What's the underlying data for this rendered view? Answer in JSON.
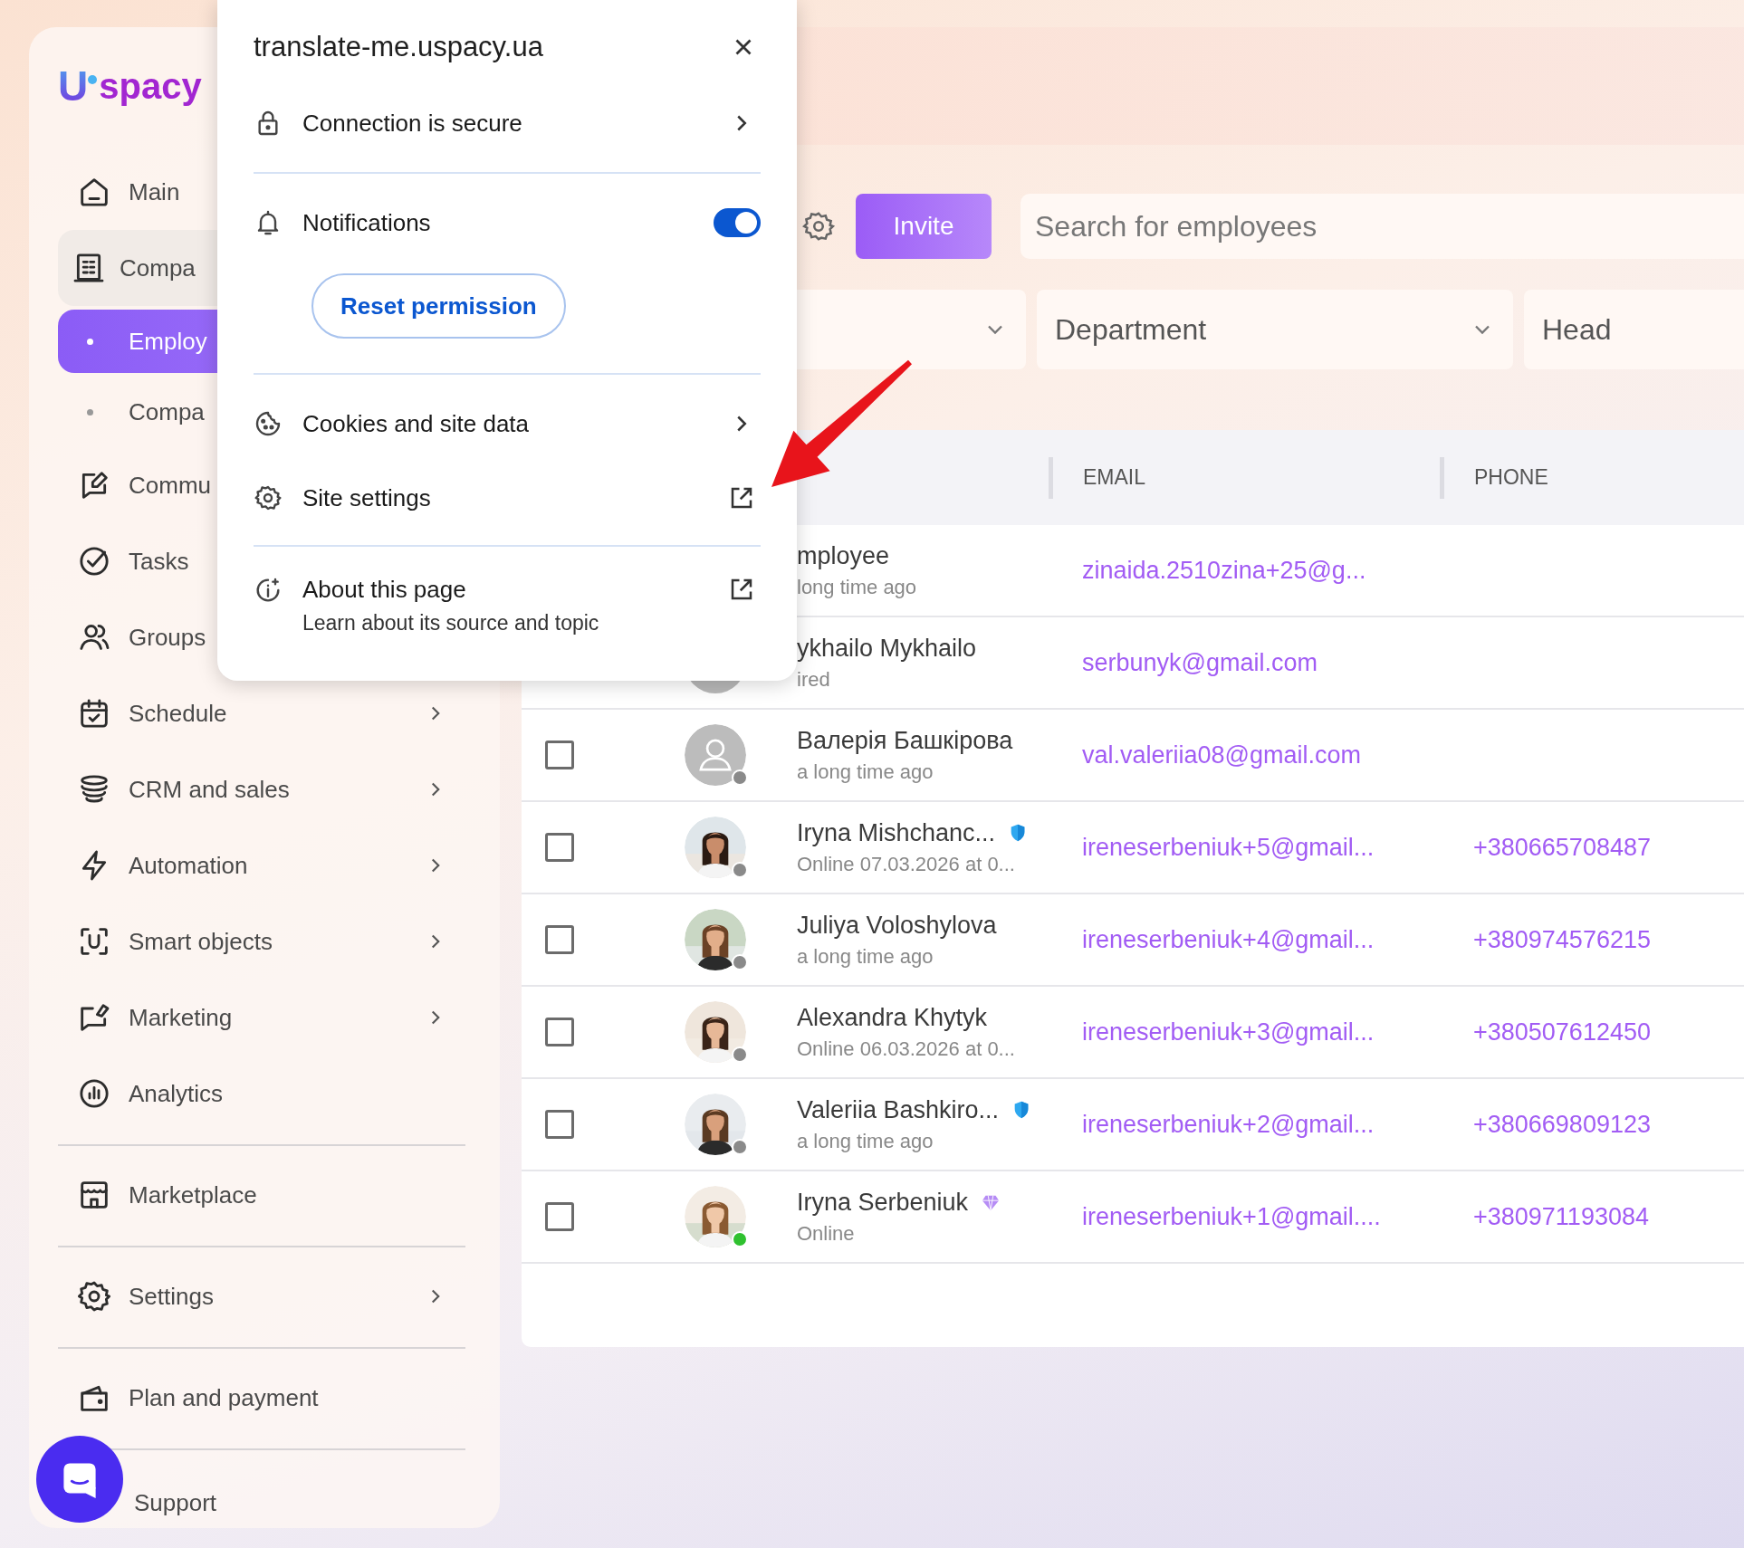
{
  "sidebar": {
    "logo": {
      "mark": "U",
      "text": "spacy"
    },
    "sections": [
      [
        {
          "kind": "item",
          "label": "Main",
          "selected": false
        },
        {
          "kind": "item",
          "label": "Compa",
          "selected": false,
          "expanded": true
        },
        {
          "kind": "sub",
          "label": "Employ",
          "selected": true
        },
        {
          "kind": "sub",
          "label": "Compa",
          "selected": false
        },
        {
          "kind": "item",
          "label": "Commu",
          "selected": false
        },
        {
          "kind": "item",
          "label": "Tasks",
          "selected": false
        },
        {
          "kind": "item",
          "label": "Groups",
          "selected": false
        },
        {
          "kind": "item",
          "label": "Schedule",
          "selected": false,
          "submenu": true
        },
        {
          "kind": "item",
          "label": "CRM and sales",
          "selected": false,
          "submenu": true
        },
        {
          "kind": "item",
          "label": "Automation",
          "selected": false,
          "submenu": true
        },
        {
          "kind": "item",
          "label": "Smart objects",
          "selected": false,
          "submenu": true
        },
        {
          "kind": "item",
          "label": "Marketing",
          "selected": false,
          "submenu": true
        },
        {
          "kind": "item",
          "label": "Analytics",
          "selected": false,
          "submenu": false
        }
      ],
      [
        {
          "kind": "item",
          "label": "Marketplace",
          "selected": false,
          "submenu": false
        }
      ],
      [
        {
          "kind": "item",
          "label": "Settings",
          "selected": false,
          "submenu": true
        }
      ],
      [
        {
          "kind": "item",
          "label": "Plan and payment",
          "selected": false,
          "submenu": false
        }
      ],
      [
        {
          "kind": "support",
          "label": "Support",
          "selected": false,
          "submenu": false
        }
      ]
    ]
  },
  "toolbar": {
    "button": "Invite",
    "search": {
      "placeholder": "Search for employees"
    }
  },
  "filters": [
    {
      "kind": "select"
    },
    {
      "kind": "select",
      "label": "Department"
    },
    {
      "kind": "input",
      "label": "Head"
    }
  ],
  "table": {
    "columns": [
      "EMAIL",
      "PHONE"
    ],
    "rows": [
      {
        "name": "mployee",
        "status": "long time ago",
        "email": "zinaida.2510zina+25@g..."
      },
      {
        "avatar": {
          "kind": "blank"
        },
        "name": "ykhailo Mykhailo",
        "status": "ired",
        "email": "serbunyk@gmail.com"
      },
      {
        "checked": false,
        "avatar": {
          "kind": "placeholder"
        },
        "color": "#8a8a8a",
        "name": "Валерія Башкірова",
        "status": "a long time ago",
        "email": "val.valeriia08@gmail.com"
      },
      {
        "checked": false,
        "color": "#8a8a8a",
        "name": "Iryna Mishchanc...",
        "badge": {
          "kind": "shield"
        },
        "status": "Online 07.03.2026 at 0...",
        "email": "ireneserbeniuk+5@gmail...",
        "phone": "+380665708487"
      },
      {
        "checked": false,
        "color": "#8a8a8a",
        "name": "Juliya Voloshylova",
        "status": "a long time ago",
        "email": "ireneserbeniuk+4@gmail...",
        "phone": "+380974576215"
      },
      {
        "checked": false,
        "color": "#8a8a8a",
        "name": "Alexandra Khytyk",
        "status": "Online 06.03.2026 at 0...",
        "email": "ireneserbeniuk+3@gmail...",
        "phone": "+380507612450"
      },
      {
        "checked": false,
        "color": "#8a8a8a",
        "name": "Valeriia Bashkiro...",
        "badge": {
          "kind": "shield"
        },
        "status": "a long time ago",
        "email": "ireneserbeniuk+2@gmail...",
        "phone": "+380669809123"
      },
      {
        "checked": false,
        "color": "#2fc12f",
        "name": "Iryna Serbeniuk",
        "badge": {
          "kind": "diamond"
        },
        "status": "Online",
        "email": "ireneserbeniuk+1@gmail....",
        "phone": "+380971193084"
      }
    ]
  },
  "popup": {
    "title": "translate-me.uspacy.ua",
    "sections": [
      [
        {
          "kind": "link",
          "label": "Connection is secure"
        }
      ],
      [
        {
          "kind": "toggle",
          "label": "Notifications",
          "on": true,
          "button": "Reset permission"
        }
      ],
      [
        {
          "kind": "link",
          "label": "Cookies and site data"
        },
        {
          "kind": "external",
          "label": "Site settings"
        }
      ],
      [
        {
          "kind": "external",
          "label": "About this page",
          "description": "Learn about its source and topic"
        }
      ]
    ]
  }
}
